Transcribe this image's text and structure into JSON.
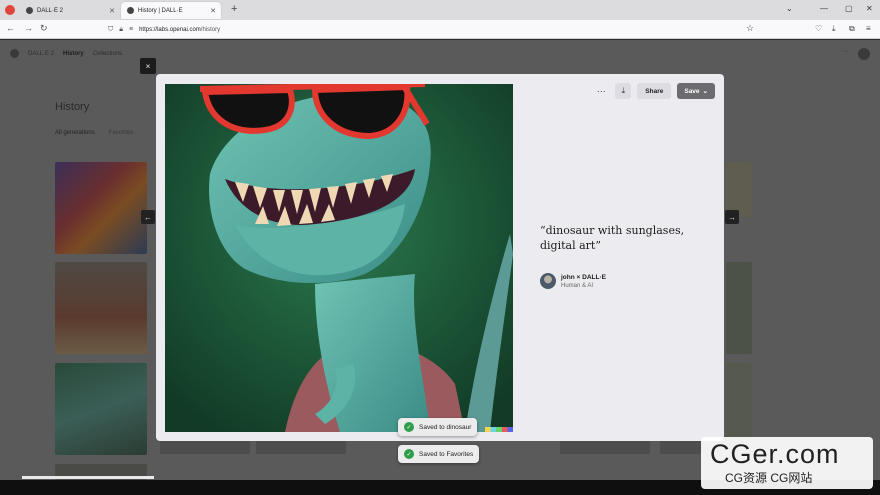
{
  "browser": {
    "tabs": [
      {
        "label": "DALL·E 2",
        "active": false
      },
      {
        "label": "History | DALL·E",
        "active": true
      }
    ],
    "url_host": "https://labs.openai.com",
    "url_path": "/history"
  },
  "page": {
    "nav": [
      "DALL·E 2",
      "History",
      "Collections"
    ],
    "title": "History",
    "subtabs": [
      "All generations",
      "Favorites"
    ]
  },
  "modal": {
    "toolbar": {
      "more": "···",
      "download": "⤓",
      "share": "Share",
      "save": "Save",
      "save_caret": "⌄"
    },
    "prompt": "“dinosaur with sunglases, digital art”",
    "author": {
      "name": "john × DALL·E",
      "subtitle": "Human & AI"
    },
    "close": "×",
    "prev": "←",
    "next": "→"
  },
  "toasts": [
    "Saved to dinosaur",
    "Saved to Favorites"
  ],
  "watermark": {
    "title": "CGer.com",
    "subtitle": "CG资源 CG网站"
  },
  "colors": {
    "modal_bg": "#ececf0",
    "save_btn": "#6b6b70",
    "toast_check": "#2e9e4b",
    "image_bg": "#184b31"
  }
}
